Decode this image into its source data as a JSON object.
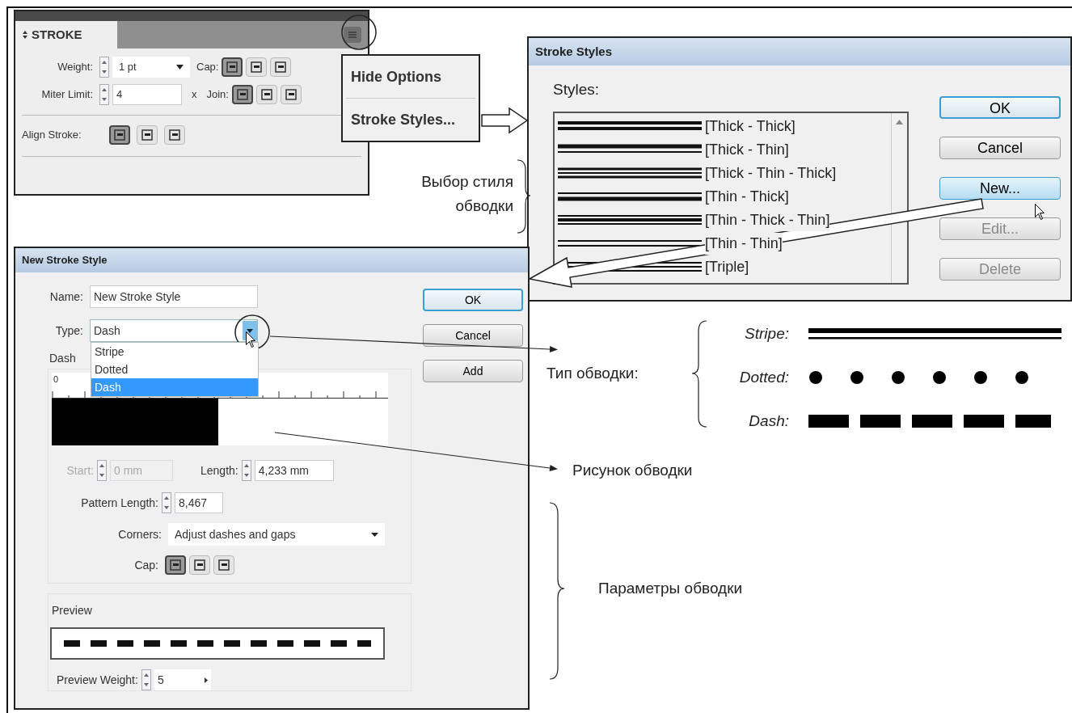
{
  "stroke_panel": {
    "tab": "STROKE",
    "weight": {
      "label": "Weight:",
      "value": "1 pt"
    },
    "cap_label": "Cap:",
    "cap_buttons": [
      {
        "selected": true
      },
      {
        "selected": false
      },
      {
        "selected": false
      }
    ],
    "miter": {
      "label": "Miter Limit:",
      "value": "4",
      "unit": "x"
    },
    "join_label": "Join:",
    "join_buttons": [
      {
        "selected": true
      },
      {
        "selected": false
      },
      {
        "selected": false
      }
    ],
    "align_label": "Align Stroke:",
    "align_buttons": [
      {
        "selected": true
      },
      {
        "selected": false
      },
      {
        "selected": false
      }
    ]
  },
  "panel_menu": {
    "items": [
      "Hide Options",
      "Stroke Styles..."
    ]
  },
  "stroke_styles_dialog": {
    "title": "Stroke Styles",
    "list_label": "Styles:",
    "styles": [
      {
        "name": "[Thick - Thick]",
        "kind": "thick-thick"
      },
      {
        "name": "[Thick - Thin]",
        "kind": "thick-thin"
      },
      {
        "name": "[Thick - Thin - Thick]",
        "kind": "thick-thin-thick"
      },
      {
        "name": "[Thin - Thick]",
        "kind": "thin-thick"
      },
      {
        "name": "[Thin - Thick - Thin]",
        "kind": "thin-thick-thin"
      },
      {
        "name": "[Thin - Thin]",
        "kind": "thin-thin"
      },
      {
        "name": "[Triple]",
        "kind": "triple"
      }
    ],
    "buttons": [
      {
        "label": "OK",
        "kind": "default",
        "disabled": false
      },
      {
        "label": "Cancel",
        "kind": "normal",
        "disabled": false
      },
      {
        "label": "New...",
        "kind": "hover",
        "disabled": false
      },
      {
        "label": "Edit...",
        "kind": "normal",
        "disabled": true
      },
      {
        "label": "Delete",
        "kind": "normal",
        "disabled": true
      }
    ]
  },
  "new_style_dialog": {
    "title": "New Stroke Style",
    "name": {
      "label": "Name:",
      "value": "New Stroke Style"
    },
    "type": {
      "label": "Type:",
      "value": "Dash",
      "options": [
        {
          "label": "Stripe",
          "selected": false
        },
        {
          "label": "Dotted",
          "selected": false
        },
        {
          "label": "Dash",
          "selected": true
        }
      ]
    },
    "buttons": [
      {
        "label": "OK",
        "kind": "default",
        "disabled": false
      },
      {
        "label": "Cancel",
        "kind": "normal",
        "disabled": false
      },
      {
        "label": "Add",
        "kind": "normal",
        "disabled": false
      }
    ],
    "section_label": "Dash",
    "ruler_start": "0",
    "start": {
      "label": "Start:",
      "value": "0 mm",
      "disabled": true
    },
    "length": {
      "label": "Length:",
      "value": "4,233 mm",
      "disabled": false
    },
    "pattern_length": {
      "label": "Pattern Length:",
      "value": "8,467"
    },
    "corners": {
      "label": "Corners:",
      "value": "Adjust dashes and gaps"
    },
    "cap_label": "Cap:",
    "cap_buttons": [
      {
        "selected": true
      },
      {
        "selected": false
      },
      {
        "selected": false
      }
    ],
    "preview": {
      "label": "Preview",
      "weight_label": "Preview Weight:",
      "weight_value": "5"
    }
  },
  "annotations": {
    "style_choice": "Выбор стиля обводки",
    "type_label": "Тип обводки:",
    "types": [
      {
        "label": "Stripe:",
        "kind": "stripe"
      },
      {
        "label": "Dotted:",
        "kind": "dotted"
      },
      {
        "label": "Dash:",
        "kind": "dash"
      }
    ],
    "pattern": "Рисунок обводки",
    "params": "Параметры обводки"
  }
}
